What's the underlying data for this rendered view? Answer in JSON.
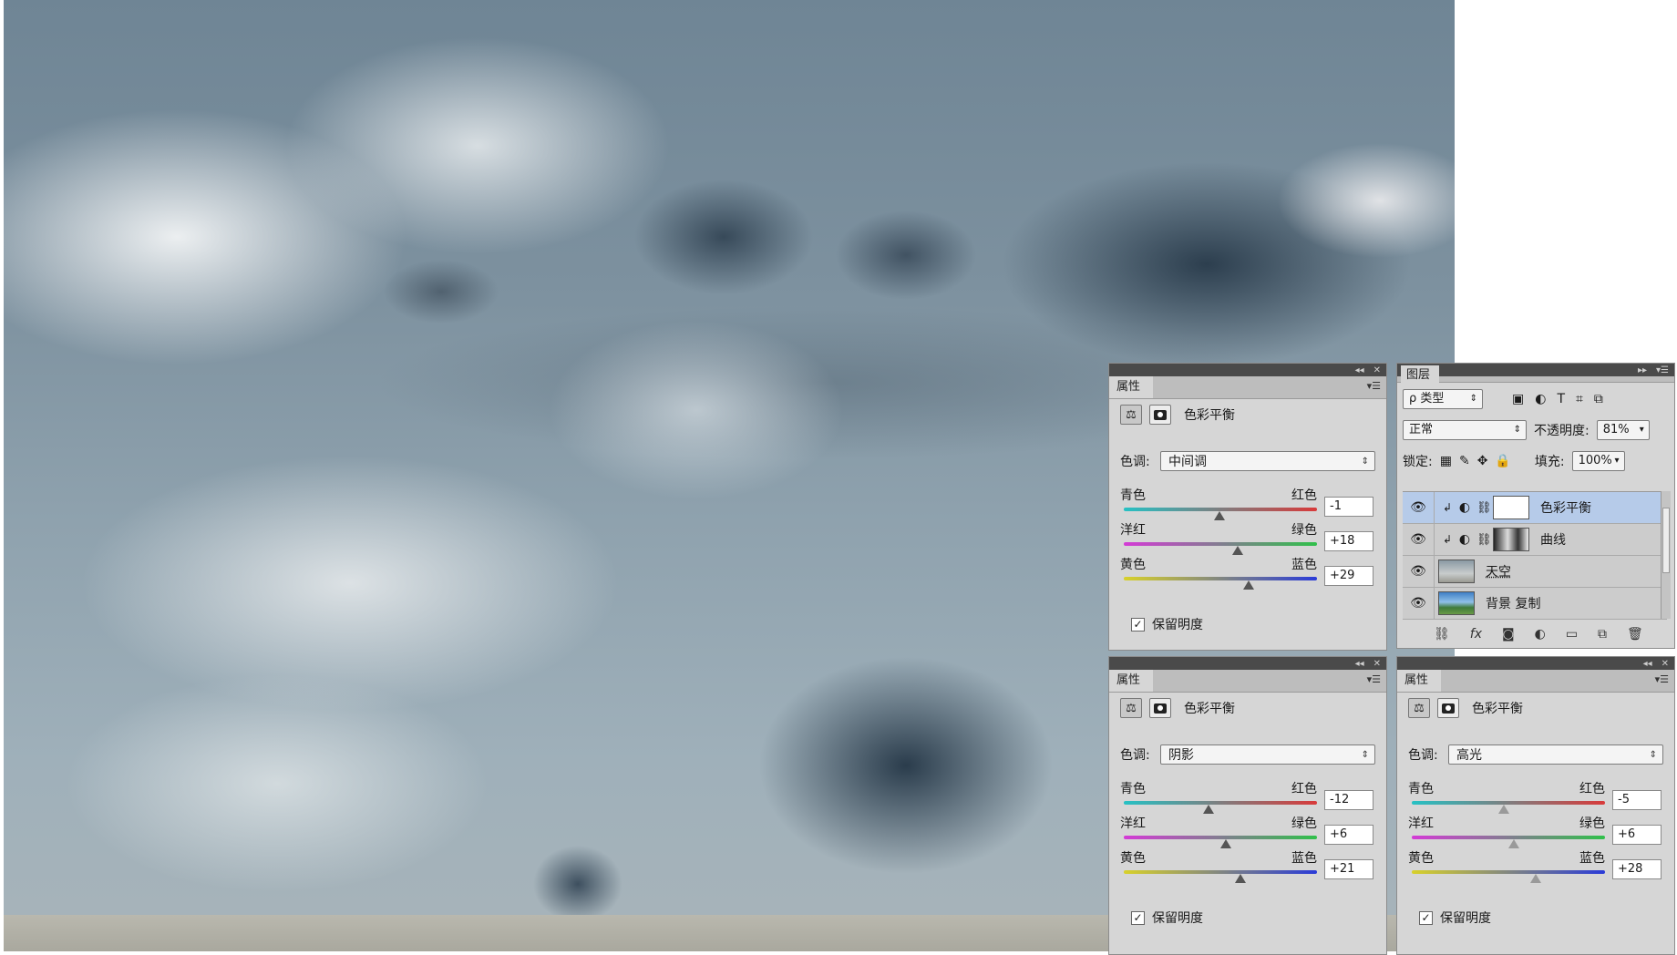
{
  "panels": {
    "mid": {
      "tab": "属性",
      "title": "色彩平衡",
      "tone_label": "色调:",
      "tone": "中间调",
      "sliders": [
        {
          "left": "青色",
          "right": "红色",
          "value": "-1",
          "level": -1
        },
        {
          "left": "洋红",
          "right": "绿色",
          "value": "+18",
          "level": 18
        },
        {
          "left": "黄色",
          "right": "蓝色",
          "value": "+29",
          "level": 29
        }
      ],
      "preserve": "保留明度"
    },
    "shadow": {
      "tab": "属性",
      "title": "色彩平衡",
      "tone_label": "色调:",
      "tone": "阴影",
      "sliders": [
        {
          "left": "青色",
          "right": "红色",
          "value": "-12",
          "level": -12
        },
        {
          "left": "洋红",
          "right": "绿色",
          "value": "+6",
          "level": 6
        },
        {
          "left": "黄色",
          "right": "蓝色",
          "value": "+21",
          "level": 21
        }
      ],
      "preserve": "保留明度"
    },
    "highlight": {
      "tab": "属性",
      "title": "色彩平衡",
      "tone_label": "色调:",
      "tone": "高光",
      "sliders": [
        {
          "left": "青色",
          "right": "红色",
          "value": "-5",
          "level": -5
        },
        {
          "left": "洋红",
          "right": "绿色",
          "value": "+6",
          "level": 6
        },
        {
          "left": "黄色",
          "right": "蓝色",
          "value": "+28",
          "level": 28
        }
      ],
      "preserve": "保留明度"
    }
  },
  "layers_panel": {
    "tab": "图层",
    "filter": "ρ 类型",
    "blend_mode": "正常",
    "opacity_label": "不透明度:",
    "opacity": "81%",
    "lock_label": "锁定:",
    "fill_label": "填充:",
    "fill": "100%",
    "layers": [
      {
        "name": "色彩平衡",
        "selected": true
      },
      {
        "name": "曲线",
        "selected": false
      },
      {
        "name": "天空",
        "selected": false
      },
      {
        "name": "背景 复制",
        "selected": false
      }
    ]
  },
  "colors": {
    "selection": "#b6cbe9",
    "panel_bg": "#d6d6d6"
  }
}
